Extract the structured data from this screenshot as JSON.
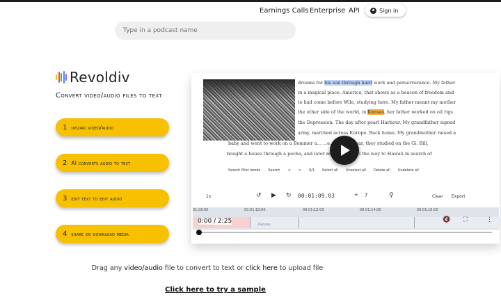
{
  "nav": {
    "earnings_calls": "Earnings Calls",
    "enterprise": "Enterprise",
    "api": "API",
    "sign_in": "Sign in"
  },
  "search": {
    "placeholder": "Type in a podcast name"
  },
  "brand": {
    "name": "Revoldiv",
    "tagline": "Convert video/audio files to text",
    "logo_colors": [
      "#f7c000",
      "#e84c4c",
      "#4caf50",
      "#3f8cff",
      "#9c5ce0"
    ]
  },
  "steps": [
    {
      "number": "1",
      "label": "upload video/audio"
    },
    {
      "number": "2",
      "label": "AI converts audio to text"
    },
    {
      "number": "3",
      "label": "edit text to edit audio"
    },
    {
      "number": "4",
      "label": "share or download media"
    }
  ],
  "preview": {
    "transcript_lines": [
      "dreams for his son through hard work and perserverance. My father",
      "in a magical place, America, that shows as a beacon of freedom and",
      "to had come before Wile, studying here. My father meant my mother",
      "the other side of the world, in Kansas, her father worked on oil rigs",
      "the Depression. The day after pearl Harbour, My grandfather signed",
      "army, marched across Europe. Back home, My grandmother raised a",
      "baby and went to work on a Bommer a... ...e. After the war, they studied on the Gi. Bill,",
      "bought a house through a pecha, and later moved west all the way to Hawaii in search of"
    ],
    "find_toolbar": [
      "Search filler words",
      "Search",
      "<",
      ">",
      "0/1",
      "Select all",
      "Unselect all",
      "Delete all",
      "Undelete all"
    ],
    "controls": {
      "speed": "1x",
      "timecode": "00:01:09.03",
      "clear": "Clear",
      "export": "Export"
    },
    "timeline_ticks": [
      "01:08:00",
      "00:01:10:00",
      "00:01:12:00",
      "00:01:14:00",
      "00:01:16:00"
    ],
    "time_display": "0:00 / 2:25",
    "track_labels": [
      "in Kansas",
      "Kansas"
    ],
    "progress": 0.0,
    "accent": "#f7c000"
  },
  "drag_text": {
    "prefix": "Drag any",
    "bold1": "video/audio",
    "middle": "file to convert to text or",
    "bold2": "click here",
    "suffix": "to upload file"
  },
  "sample_link": "Click here to try a sample"
}
